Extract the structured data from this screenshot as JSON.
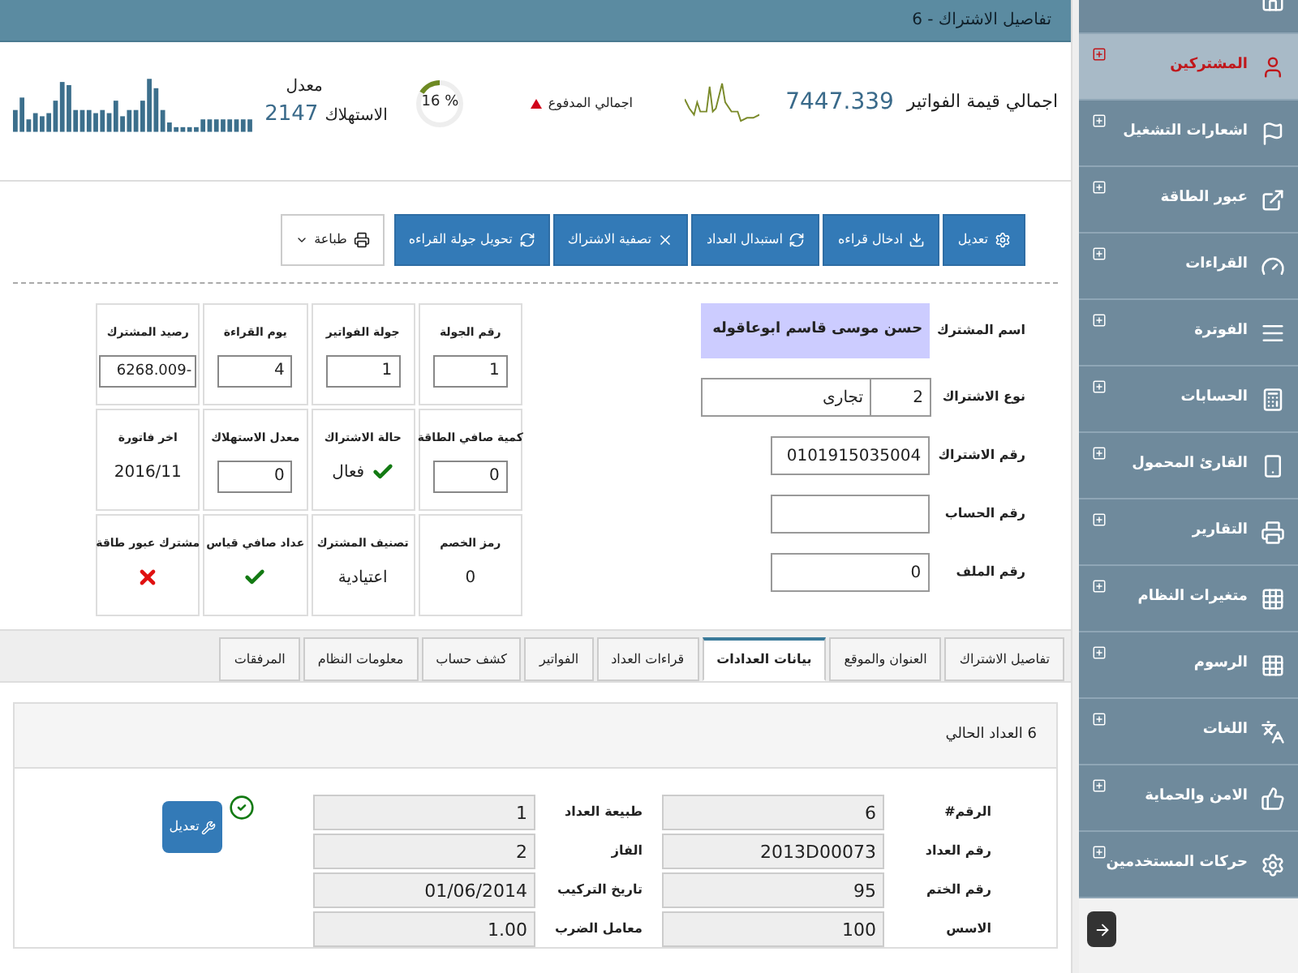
{
  "sidebar": {
    "items": [
      {
        "selected": false
      },
      {
        "label": "المشتركين",
        "selected": true
      },
      {
        "label": "اشعارات التشغيل",
        "selected": false
      },
      {
        "label": "عبور الطاقة",
        "selected": false
      },
      {
        "label": "القراءات",
        "selected": false
      },
      {
        "label": "الفوترة",
        "selected": false
      },
      {
        "label": "الحسابات",
        "selected": false
      },
      {
        "label": "القارئ المحمول",
        "selected": false
      },
      {
        "label": "التقارير",
        "selected": false
      },
      {
        "label": "متغيرات النظام",
        "selected": false
      },
      {
        "label": "الرسوم",
        "selected": false
      },
      {
        "label": "اللغات",
        "selected": false
      },
      {
        "label": "الامن والحماية",
        "selected": false
      },
      {
        "label": "حركات المستخدمين",
        "selected": false
      }
    ]
  },
  "title_bar": {
    "title": "تفاصيل الاشتراك - 6"
  },
  "stats": {
    "invoices_total": {
      "label": "اجمالي قيمة الفواتير",
      "value": "7447.339"
    },
    "paid": {
      "label": "اجمالي المدفوع",
      "percent": "% 16",
      "level": 0.16
    },
    "consumption": {
      "label_1": "معدل",
      "label_2": "الاستهلاك",
      "value": "2147"
    }
  },
  "actions": [
    {
      "label": "تعديل",
      "kind": "button"
    },
    {
      "label": "ادخال قراءه",
      "kind": "button"
    },
    {
      "label": "استبدال العداد",
      "kind": "button"
    },
    {
      "label": "تصفية الاشتراك",
      "kind": "button"
    },
    {
      "label": "تحويل جولة القراءه",
      "kind": "button"
    },
    {
      "label": "طباعة",
      "kind": "dropdown"
    }
  ],
  "form": {
    "subscriber_name": {
      "label": "اسم المشترك",
      "value": "حسن موسى قاسم ابوعاقوله"
    },
    "subscription_type": {
      "label": "نوع الاشتراك",
      "code": "2",
      "name": "تجارى"
    },
    "subscription_number": {
      "label": "رقم الاشتراك",
      "value": "0101915035004"
    },
    "account_number": {
      "label": "رقم الحساب"
    },
    "file_number": {
      "label": "رقم الملف",
      "value": "0"
    }
  },
  "info_grid": [
    {
      "label": "رقم الجولة",
      "kind": "input",
      "value": "1"
    },
    {
      "label": "جولة الفواتير",
      "kind": "input",
      "value": "1"
    },
    {
      "label": "يوم القراءة",
      "kind": "input",
      "value": "4"
    },
    {
      "label": "رصيد المشترك",
      "kind": "input",
      "value": "6268.009-"
    },
    {
      "label": "كمية صافي الطاقة",
      "kind": "input",
      "value": "0"
    },
    {
      "label": "حالة الاشتراك",
      "kind": "flag",
      "checked": true,
      "value": "فعال"
    },
    {
      "label": "معدل الاستهلاك",
      "kind": "input",
      "value": "0"
    },
    {
      "label": "اخر فاتورة",
      "kind": "text",
      "value": "2016/11"
    },
    {
      "label": "رمز الخصم",
      "kind": "text",
      "value": "0"
    },
    {
      "label": "تصنيف المشترك",
      "kind": "text",
      "value": "اعتيادية"
    },
    {
      "label": "عداد صافي قياس",
      "kind": "flag",
      "checked": true
    },
    {
      "label": "مشترك عبور طاقة",
      "kind": "flag",
      "checked": false
    }
  ],
  "tabs": [
    {
      "label": "تفاصيل الاشتراك",
      "selected": false
    },
    {
      "label": "العنوان والموقع",
      "selected": false
    },
    {
      "label": "بيانات العدادات",
      "selected": true
    },
    {
      "label": "قراءات العداد",
      "selected": false
    },
    {
      "label": "الفواتير",
      "selected": false
    },
    {
      "label": "كشف حساب",
      "selected": false
    },
    {
      "label": "معلومات النظام",
      "selected": false
    },
    {
      "label": "المرفقات",
      "selected": false
    }
  ],
  "meter_panel": {
    "heading": "6 العداد الحالي",
    "active": true,
    "edit_button": "تعديل",
    "columns": [
      [
        {
          "label": "الرقم#",
          "value": "6"
        },
        {
          "label": "رقم العداد",
          "value": "2013D00073"
        },
        {
          "label": "رقم الختم",
          "value": "95"
        },
        {
          "label": "الاسس",
          "value": "100"
        }
      ],
      [
        {
          "label": "طبيعة العداد",
          "value": "1"
        },
        {
          "label": "الفاز",
          "value": "2"
        },
        {
          "label": "تاريخ التركيب",
          "value": "01/06/2014"
        },
        {
          "label": "معامل الضرب",
          "value": "1.00"
        }
      ]
    ]
  }
}
